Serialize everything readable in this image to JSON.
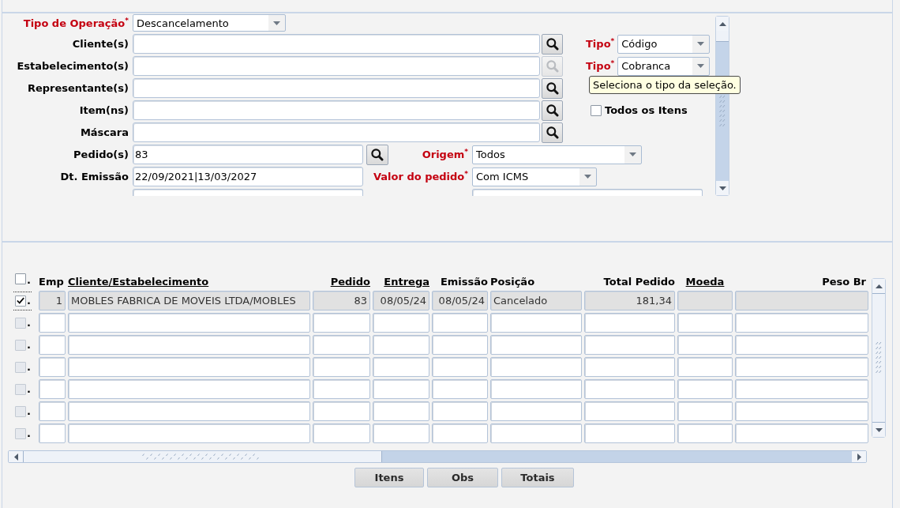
{
  "filters": [
    {
      "kind": "select",
      "label": "Tipo de Operação$^{*}$",
      "required": true,
      "value": "Descancelamento"
    },
    {
      "kind": "lookup",
      "label": "Cliente(s)",
      "required": false,
      "search": {
        "disabled": false
      },
      "side": {
        "kind": "select",
        "label": "Tipo$^{*}$",
        "required": true,
        "value": "Código"
      }
    },
    {
      "kind": "lookup",
      "label": "Estabelecimento(s)",
      "required": false,
      "search": {
        "disabled": true
      },
      "side": {
        "kind": "select",
        "label": "Tipo$^{*}$",
        "required": true,
        "value": "Cobranca"
      }
    },
    {
      "kind": "lookup",
      "label": "Representante(s)",
      "required": false,
      "search": {
        "disabled": false
      }
    },
    {
      "kind": "lookup",
      "label": "Item(ns)",
      "required": false,
      "search": {
        "disabled": false
      },
      "side": {
        "kind": "checkbox",
        "label": "Todos os Itens",
        "checked": false
      }
    },
    {
      "kind": "lookup",
      "label": "Máscara",
      "required": false,
      "search": {
        "disabled": false
      }
    },
    {
      "kind": "short",
      "label": "Pedido(s)",
      "required": false,
      "value": "83",
      "search": {
        "disabled": false
      },
      "side": {
        "kind": "select",
        "label": "Origem$^{*}$",
        "required": true,
        "value": "Todos"
      }
    },
    {
      "kind": "short",
      "label": "Dt. Emissão",
      "required": false,
      "value": "22/09/2021|13/03/2027",
      "side": {
        "kind": "select",
        "label": "Valor do pedido$^{*}$",
        "required": true,
        "value": "Com ICMS"
      }
    },
    {
      "kind": "partial",
      "side": {
        "kind": "text"
      }
    }
  ],
  "tooltip": {
    "text": "Seleciona o tipo da seleção."
  },
  "table": {
    "select_all": {
      "checked": false,
      "label": "."
    },
    "columns": [
      {
        "label": "Emp",
        "underlined": false
      },
      {
        "label": "Cliente/Estabelecimento",
        "underlined": true
      },
      {
        "label": "Pedido",
        "underlined": true
      },
      {
        "label": "Entrega",
        "underlined": true
      },
      {
        "label": "Emissão",
        "underlined": false
      },
      {
        "label": "Posição",
        "underlined": false
      },
      {
        "label": "Total Pedido",
        "underlined": false
      },
      {
        "label": "Moeda",
        "underlined": true
      },
      {
        "label": "Peso Br",
        "underlined": false
      }
    ],
    "rows": [
      {
        "selected": true,
        "checked": true,
        "disabled": false,
        "readonly": true,
        "label": ".",
        "cells": [
          "1",
          "MOBLES FABRICA DE MOVEIS LTDA/MOBLES",
          "83",
          "08/05/24",
          "08/05/24",
          "Cancelado",
          "181,34"
        ]
      },
      {
        "selected": false,
        "checked": false,
        "disabled": true,
        "readonly": false,
        "label": "."
      },
      {
        "selected": false,
        "checked": false,
        "disabled": true,
        "readonly": false,
        "label": "."
      },
      {
        "selected": false,
        "checked": false,
        "disabled": true,
        "readonly": false,
        "label": "."
      },
      {
        "selected": false,
        "checked": false,
        "disabled": true,
        "readonly": false,
        "label": "."
      },
      {
        "selected": false,
        "checked": false,
        "disabled": true,
        "readonly": false,
        "label": "."
      },
      {
        "selected": false,
        "checked": false,
        "disabled": true,
        "readonly": false,
        "label": "."
      }
    ]
  },
  "buttons": [
    {
      "label": "Itens"
    },
    {
      "label": "Obs"
    },
    {
      "label": "Totais"
    }
  ]
}
